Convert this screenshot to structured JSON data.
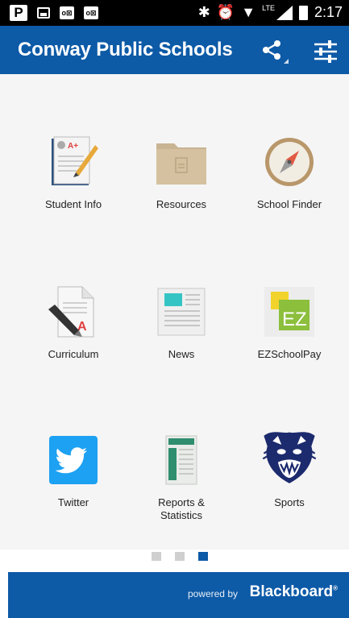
{
  "statusbar": {
    "time": "2:17",
    "network": "LTE",
    "icons": [
      "parking-icon",
      "gallery-icon",
      "outlook-icon",
      "outlook-icon",
      "bluetooth-icon",
      "alarm-icon",
      "wifi-icon",
      "signal-icon",
      "battery-icon"
    ]
  },
  "appbar": {
    "title": "Conway Public Schools",
    "share_icon": "share-icon",
    "settings_icon": "tune-icon",
    "color": "#0d5aa7"
  },
  "tiles": [
    {
      "label": "Student Info",
      "icon": "student-info-icon"
    },
    {
      "label": "Resources",
      "icon": "folder-icon"
    },
    {
      "label": "School Finder",
      "icon": "compass-icon"
    },
    {
      "label": "Curriculum",
      "icon": "curriculum-icon"
    },
    {
      "label": "News",
      "icon": "news-icon"
    },
    {
      "label": "EZSchoolPay",
      "icon": "ezschoolpay-icon"
    },
    {
      "label": "Twitter",
      "icon": "twitter-icon"
    },
    {
      "label": "Reports & Statistics",
      "icon": "reports-icon"
    },
    {
      "label": "Sports",
      "icon": "panther-logo-icon"
    }
  ],
  "pagination": {
    "pages": 3,
    "current": 3
  },
  "footer": {
    "powered_by": "powered by",
    "brand": "Blackboard",
    "trademark": "®"
  }
}
